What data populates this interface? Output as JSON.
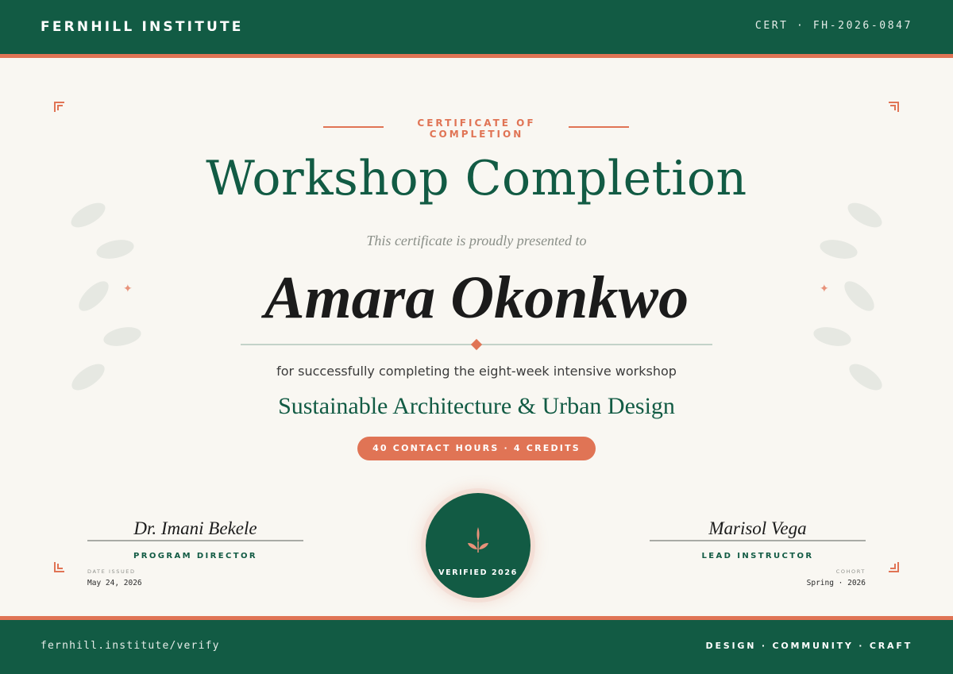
{
  "header": {
    "brand": "FERNHILL INSTITUTE",
    "cert_number": "CERT · FH-2026-0847"
  },
  "certificate": {
    "eyebrow_line1": "CERTIFICATE OF",
    "eyebrow_line2": "COMPLETION",
    "title": "Workshop Completion",
    "presented_text": "This certificate is proudly presented to",
    "recipient": "Amara Okonkwo",
    "lead_text": "for successfully completing the eight-week intensive workshop",
    "course": "Sustainable Architecture & Urban Design",
    "credits_badge": "40 CONTACT HOURS · 4 CREDITS"
  },
  "signatures": {
    "left": {
      "name": "Dr. Imani Bekele",
      "role": "PROGRAM DIRECTOR",
      "meta_label": "DATE ISSUED",
      "meta_value": "May 24, 2026"
    },
    "right": {
      "name": "Marisol Vega",
      "role": "LEAD INSTRUCTOR",
      "meta_label": "COHORT",
      "meta_value": "Spring · 2026"
    }
  },
  "seal": {
    "icon": "sprout-icon",
    "text": "VERIFIED 2026"
  },
  "footer": {
    "verify_url": "fernhill.institute/verify",
    "tagline": "DESIGN · COMMUNITY · CRAFT"
  },
  "colors": {
    "brand_green": "#125b44",
    "accent_coral": "#e07455",
    "paper": "#f9f7f2"
  }
}
